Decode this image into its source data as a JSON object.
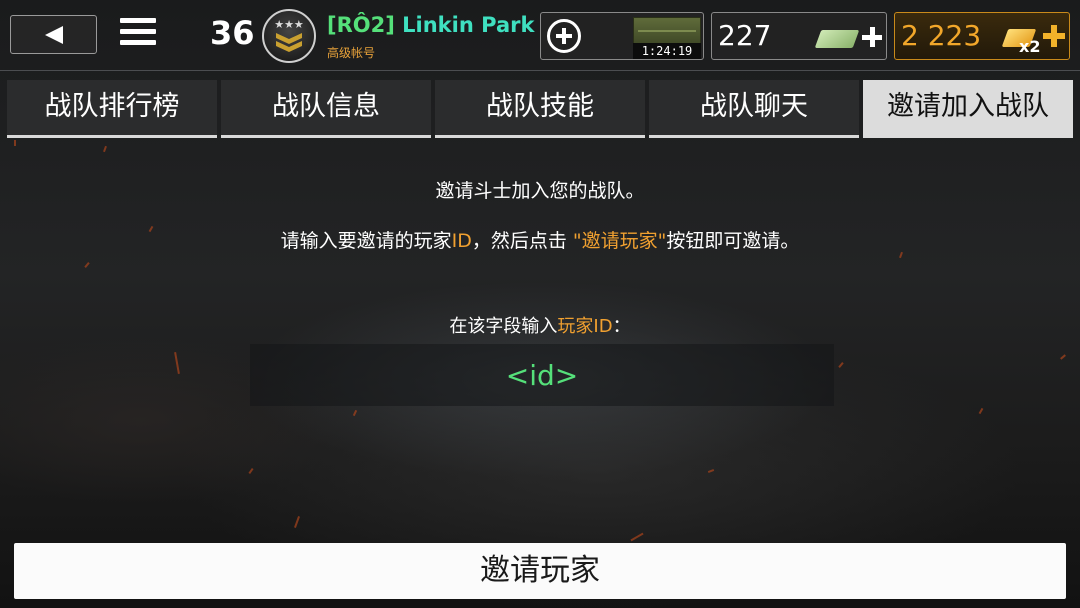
{
  "header": {
    "level": "36",
    "clan_tag": "[RÔ2]",
    "player_name": "Linkin Park",
    "account_type": "高级帐号",
    "crate_timer": "1:24:19",
    "cash": "227",
    "gold": "2 223",
    "gold_multiplier": "x2"
  },
  "tabs": [
    {
      "label": "战队排行榜",
      "active": false
    },
    {
      "label": "战队信息",
      "active": false
    },
    {
      "label": "战队技能",
      "active": false
    },
    {
      "label": "战队聊天",
      "active": false
    },
    {
      "label": "邀请加入战队",
      "active": true
    }
  ],
  "content": {
    "intro": "邀请斗士加入您的战队。",
    "instruction_part1": "请输入要邀请的玩家",
    "instruction_id": "ID",
    "instruction_part2": "，然后点击",
    "instruction_button_ref": "\"邀请玩家\"",
    "instruction_part3": "按钮即可邀请。",
    "field_label_part1": "在该字段输入",
    "field_label_highlight": "玩家ID",
    "field_label_colon": "：",
    "id_placeholder": "<id>",
    "invite_button": "邀请玩家"
  },
  "colors": {
    "name_green": "#55e07a",
    "highlight_orange": "#f0a030",
    "gold": "#f2a72a"
  },
  "icons": [
    "back-arrow-icon",
    "menu-icon",
    "rank-badge-icon",
    "add-circle-icon",
    "crate-icon",
    "cash-icon",
    "plus-icon",
    "gold-bar-icon"
  ]
}
